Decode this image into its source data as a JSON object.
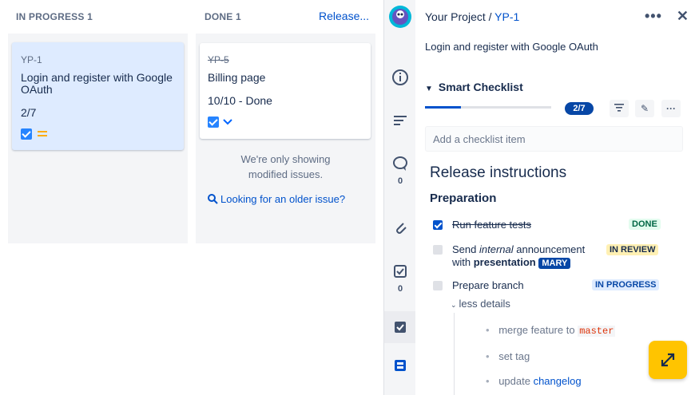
{
  "board": {
    "columns": [
      {
        "title": "IN PROGRESS 1"
      },
      {
        "title": "DONE 1"
      }
    ],
    "release_label": "Release...",
    "cards": [
      {
        "key": "YP-1",
        "title": "Login and register with Google OAuth",
        "meta": "2/7",
        "priority_icon": "medium-priority-icon"
      },
      {
        "key": "YP-5",
        "title": "Billing page",
        "meta": "10/10 - Done",
        "priority_icon": "low-priority-icon"
      }
    ],
    "info_line1": "We're only showing",
    "info_line2": "modified issues.",
    "older_link": "Looking for an older issue?"
  },
  "rail": {
    "comment_count": "0",
    "checklist_count": "0"
  },
  "detail": {
    "project": "Your Project",
    "separator": " / ",
    "issue_key": "YP-1",
    "summary": "Login and register with Google OAuth",
    "checklist_title": "Smart Checklist",
    "progress_label": "2/7",
    "progress_fraction": 0.2857,
    "add_placeholder": "Add a checklist item",
    "heading": "Release instructions",
    "subheading": "Preparation",
    "items": [
      {
        "text": "Run feature tests",
        "status": "DONE"
      },
      {
        "text_pre": "Send ",
        "text_em": "internal",
        "text_mid": " announcement",
        "text_line2_pre": "with ",
        "text_bold": "presentation",
        "mention": "MARY",
        "status": "IN REVIEW"
      },
      {
        "text": "Prepare branch",
        "status": "IN PROGRESS"
      }
    ],
    "less_details": "less details",
    "sub_items": [
      {
        "pre": "merge feature to ",
        "code": "master"
      },
      {
        "pre": "set tag"
      },
      {
        "pre": "update ",
        "link": "changelog"
      }
    ]
  },
  "colors": {
    "accent": "#0052CC",
    "highlight_card": "#DEEBFF",
    "fab": "#FFC400"
  }
}
